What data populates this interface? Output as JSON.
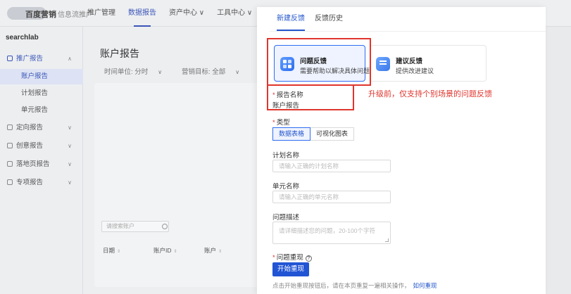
{
  "app": {
    "brand": "百度营销",
    "brand_sub": "信息流推广",
    "nav": [
      "推广管理",
      "数据报告",
      "资产中心 ∨",
      "工具中心 ∨"
    ]
  },
  "sidebar": {
    "account": "searchlab",
    "group_label": "推广报告",
    "sub_items": [
      "账户报告",
      "计划报告",
      "单元报告"
    ],
    "other_groups": [
      "定向报告",
      "创意报告",
      "落地页报告",
      "专项报告"
    ]
  },
  "main": {
    "title": "账户报告",
    "filter_time": "时间单位: 分时",
    "filter_goal": "营销目标: 全部",
    "search_placeholder": "请搜索账户",
    "columns": [
      "日期",
      "账户ID",
      "账户"
    ]
  },
  "drawer": {
    "tabs": [
      "新建反馈",
      "反馈历史"
    ],
    "cards": [
      {
        "title": "问题反馈",
        "desc": "需要帮助以解决具体问题"
      },
      {
        "title": "建议反馈",
        "desc": "提供改进建议"
      }
    ],
    "annotation": "升级前，仅支持个别场景的问题反馈",
    "report_name_label": "报告名称",
    "report_name_value": "账户报告",
    "type_label": "类型",
    "type_options": [
      "数据表格",
      "可视化图表"
    ],
    "plan_label": "计划名称",
    "plan_placeholder": "请输入正确的计划名称",
    "unit_label": "单元名称",
    "unit_placeholder": "请输入正确的单元名称",
    "desc_label": "问题描述",
    "desc_placeholder": "请详细描述您的问题，20-100个字符",
    "repro_label": "问题重现",
    "repro_button": "开始重现",
    "hint": "点击开始重现按钮后，请在本页重复一遍相关操作，",
    "hint_link": "如何重现"
  },
  "colors": {
    "primary": "#2255d4",
    "annotation_red": "#e0352d"
  }
}
